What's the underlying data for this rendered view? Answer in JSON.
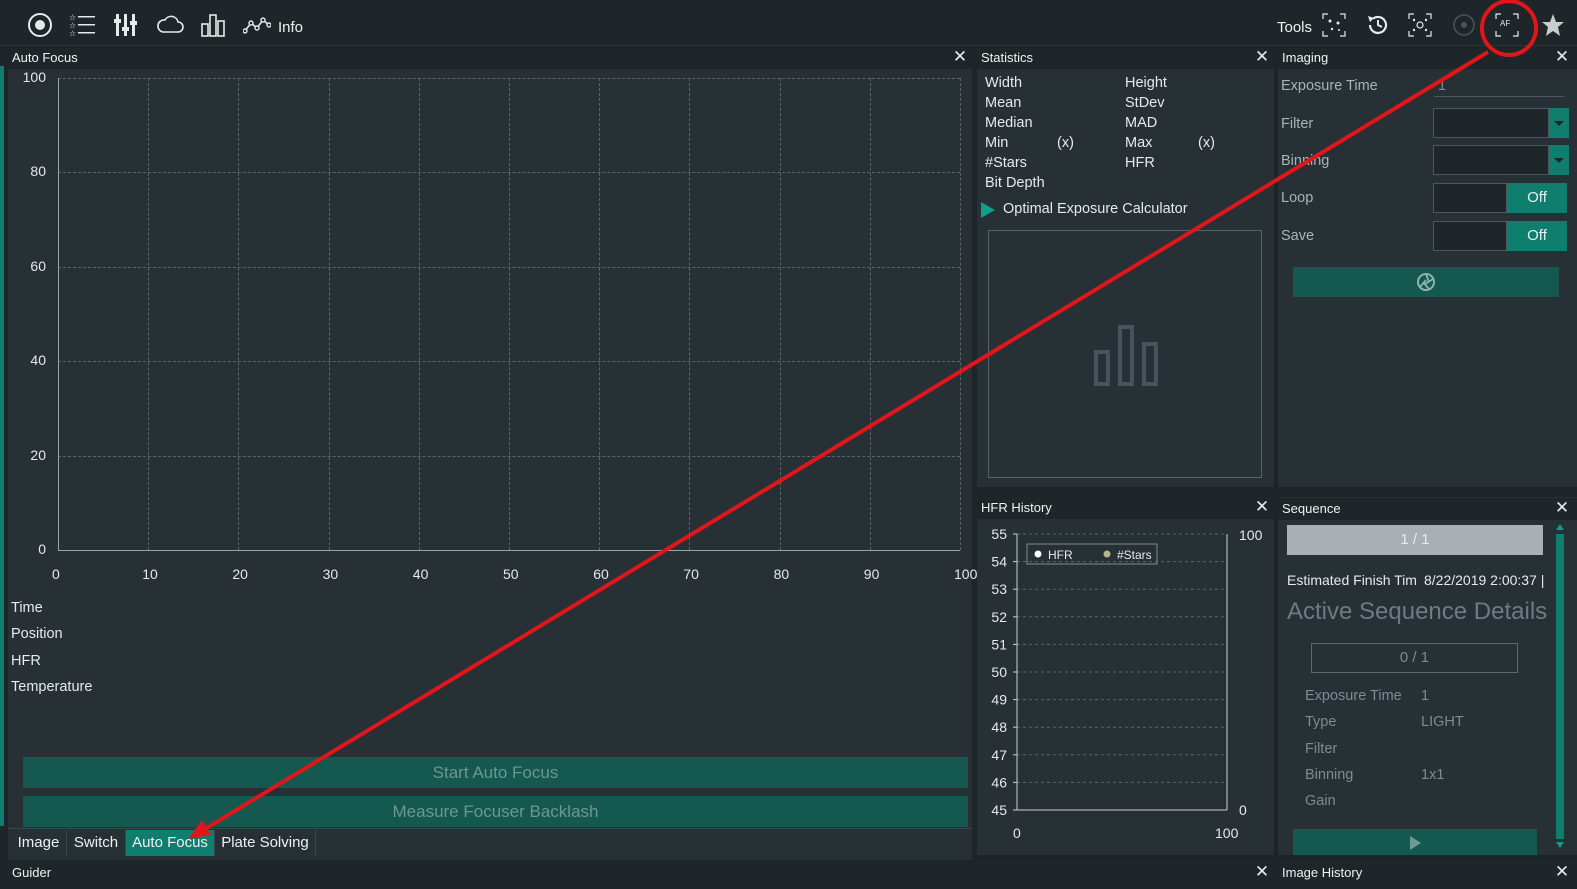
{
  "toolbar": {
    "info_label": "Info",
    "tools_label": "Tools",
    "af_label": "AF"
  },
  "autofocus": {
    "title": "Auto Focus",
    "chart_data": {
      "type": "line",
      "x_ticks": [
        "0",
        "10",
        "20",
        "30",
        "40",
        "50",
        "60",
        "70",
        "80",
        "90",
        "100"
      ],
      "y_ticks": [
        "100",
        "80",
        "60",
        "40",
        "20",
        "0"
      ],
      "xlim": [
        0,
        100
      ],
      "ylim": [
        0,
        100
      ],
      "series": [],
      "grid": true
    },
    "info_labels": [
      "Time",
      "Position",
      "HFR",
      "Temperature"
    ],
    "start_button": "Start Auto Focus",
    "backlash_button": "Measure Focuser Backlash"
  },
  "tabs": [
    "Image",
    "Switch",
    "Auto Focus",
    "Plate Solving"
  ],
  "active_tab": "Auto Focus",
  "statistics": {
    "title": "Statistics",
    "left_labels": [
      "Width",
      "Mean",
      "Median",
      "Min",
      "#Stars",
      "Bit Depth"
    ],
    "right_labels": [
      "Height",
      "StDev",
      "MAD",
      "Max",
      "HFR"
    ],
    "min_suffix": "(x)",
    "max_suffix": "(x)",
    "optimal_exposure": "Optimal Exposure Calculator"
  },
  "hfr_history": {
    "title": "HFR History",
    "chart_data": {
      "type": "line",
      "y_left_ticks": [
        "55",
        "54",
        "53",
        "52",
        "51",
        "50",
        "49",
        "48",
        "47",
        "46",
        "45"
      ],
      "y_right_ticks": [
        "100",
        "0"
      ],
      "x_ticks": [
        "0",
        "100"
      ],
      "ylim": [
        45,
        55
      ],
      "y2lim": [
        0,
        100
      ],
      "xlim": [
        0,
        100
      ],
      "series": [
        {
          "name": "HFR",
          "values": []
        },
        {
          "name": "#Stars",
          "values": []
        }
      ],
      "legend": "top-left",
      "grid": true
    }
  },
  "imaging": {
    "title": "Imaging",
    "exposure_label": "Exposure Time",
    "exposure_value": "1",
    "filter_label": "Filter",
    "binning_label": "Binning",
    "loop_label": "Loop",
    "loop_value": "Off",
    "save_label": "Save",
    "save_value": "Off"
  },
  "sequence": {
    "title": "Sequence",
    "progress": "1 / 1",
    "finish_label": "Estimated Finish Tim",
    "finish_value": "8/22/2019 2:00:37 |",
    "active_title": "Active Sequence Details",
    "sub_progress": "0 / 1",
    "details": [
      {
        "label": "Exposure Time",
        "value": "1"
      },
      {
        "label": "Type",
        "value": "LIGHT"
      },
      {
        "label": "Filter",
        "value": ""
      },
      {
        "label": "Binning",
        "value": "1x1"
      },
      {
        "label": "Gain",
        "value": ""
      }
    ]
  },
  "bottom": {
    "guider_title": "Guider",
    "image_history_title": "Image History"
  },
  "colors": {
    "accent": "#0f7e6f",
    "annotation": "#e0161b"
  }
}
